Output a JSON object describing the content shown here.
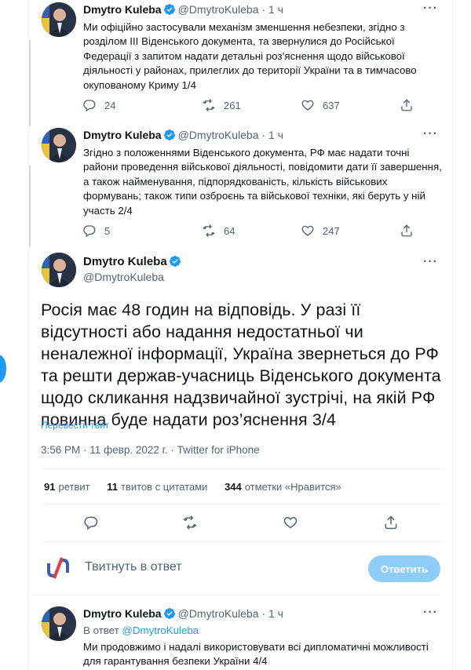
{
  "author": {
    "name": "Dmytro Kuleba",
    "handle": "@DmytroKuleba"
  },
  "tweets": [
    {
      "time": "1 ч",
      "text": "Ми офіційно застосували механізм зменшення небезпеки, згідно з розділом ІІІ Віденського документа, та звернулися до Російської Федерації з запитом надати детальні роз’яснення щодо військової діяльності у районах, прилеглих до території України та в тимчасово окупованому Криму 1/4",
      "replies": "24",
      "retweets": "261",
      "likes": "637"
    },
    {
      "time": "1 ч",
      "text": "Згідно з положеннями Віденського документа, РФ має надати точні райони проведення військової діяльності, повідомити дати її завершення, а також найменування, підпорядкованість, кількість військових формувань; також типи озброєнь та військової техніки, які беруть у ній участь 2/4",
      "replies": "5",
      "retweets": "64",
      "likes": "247"
    }
  ],
  "main_tweet": {
    "text": "Росія має 48 годин на відповідь. У разі її відсутності або надання недостатньої чи неналежної інформації, Україна звернеться до РФ та решти держав-учасниць Віденського документа щодо скликання надзвичайної зустрічі, на якій РФ повинна буде надати роз’яснення 3/4",
    "translate": "Перевести твит",
    "timestamp": "3:56 PM · 11 февр. 2022 г. · Twitter for iPhone",
    "retweets_count": "91",
    "retweets_label": "ретвит",
    "quotes_count": "11",
    "quotes_label": "твитов с цитатами",
    "likes_count": "344",
    "likes_label": "отметки «Нравится»"
  },
  "reply_box": {
    "placeholder": "Твитнуть в ответ",
    "button": "Ответить"
  },
  "last_tweet": {
    "time": "1 ч",
    "reply_prefix": "В ответ",
    "reply_to": "@DmytroKuleba",
    "text": "Ми продовжимо і надалі використовувати всі дипломатичні можливості для гарантування безпеки України 4/4"
  },
  "icons": {
    "verified": "verified-badge-icon",
    "reply": "reply-icon",
    "retweet": "retweet-icon",
    "like": "heart-icon",
    "share": "share-icon",
    "more": "more-icon"
  },
  "colors": {
    "accent": "#1d9bf0",
    "muted": "#536471",
    "reply_button_disabled": "#8ecdf7"
  }
}
